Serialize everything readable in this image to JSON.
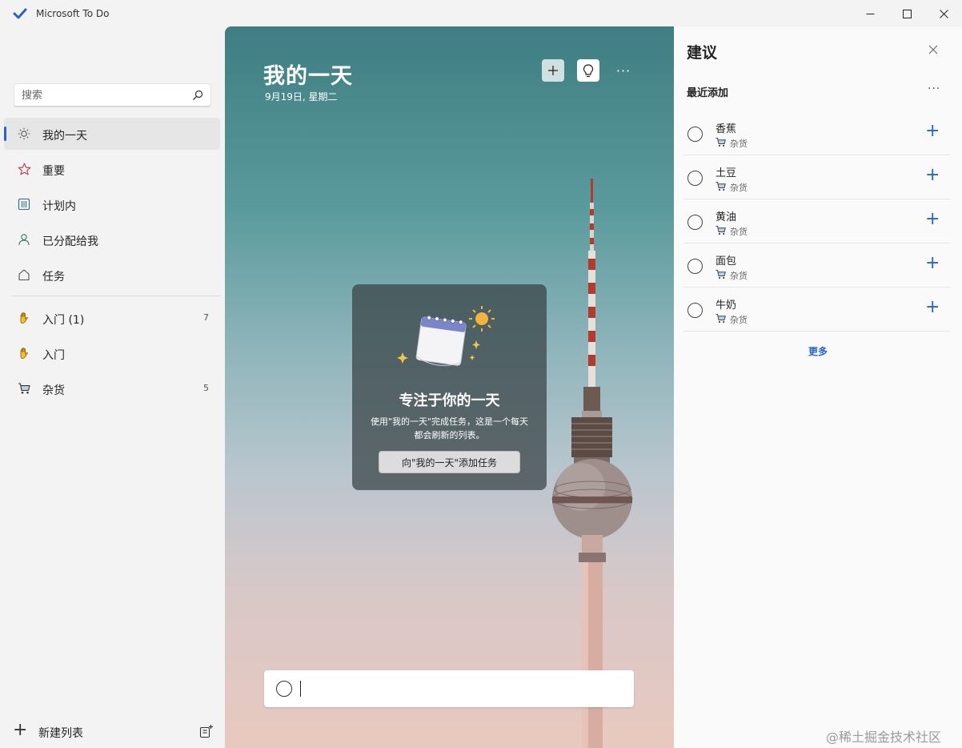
{
  "window": {
    "title": "Microsoft To Do",
    "controls": [
      "minimize",
      "maximize",
      "close"
    ]
  },
  "sidebar": {
    "search_placeholder": "搜索",
    "nav": [
      {
        "label": "我的一天",
        "icon": "sun-icon",
        "active": true
      },
      {
        "label": "重要",
        "icon": "star-icon"
      },
      {
        "label": "计划内",
        "icon": "calendar-grid-icon"
      },
      {
        "label": "已分配给我",
        "icon": "person-icon"
      },
      {
        "label": "任务",
        "icon": "home-icon"
      }
    ],
    "lists": [
      {
        "label": "入门 (1)",
        "icon": "waving-hand-icon",
        "count": "7"
      },
      {
        "label": "入门",
        "icon": "waving-hand-icon",
        "count": ""
      },
      {
        "label": "杂货",
        "icon": "shopping-cart-icon",
        "count": "5"
      }
    ],
    "new_list_label": "新建列表"
  },
  "main": {
    "title": "我的一天",
    "date": "9月19日, 星期二",
    "focus_card": {
      "title": "专注于你的一天",
      "description": "使用\"我的一天\"完成任务，这是一个每天都会刷新的列表。",
      "button": "向\"我的一天\"添加任务"
    },
    "add_task_value": ""
  },
  "suggestions": {
    "title": "建议",
    "section": "最近添加",
    "items": [
      {
        "name": "香蕉",
        "list": "杂货"
      },
      {
        "name": "土豆",
        "list": "杂货"
      },
      {
        "name": "黄油",
        "list": "杂货"
      },
      {
        "name": "面包",
        "list": "杂货"
      },
      {
        "name": "牛奶",
        "list": "杂货"
      }
    ],
    "load_more": "更多"
  },
  "watermark": "@稀土掘金技术社区",
  "colors": {
    "accent": "#2564cf",
    "sidebar_bg": "#f3f3f3",
    "panel_bg": "#fafafa"
  }
}
